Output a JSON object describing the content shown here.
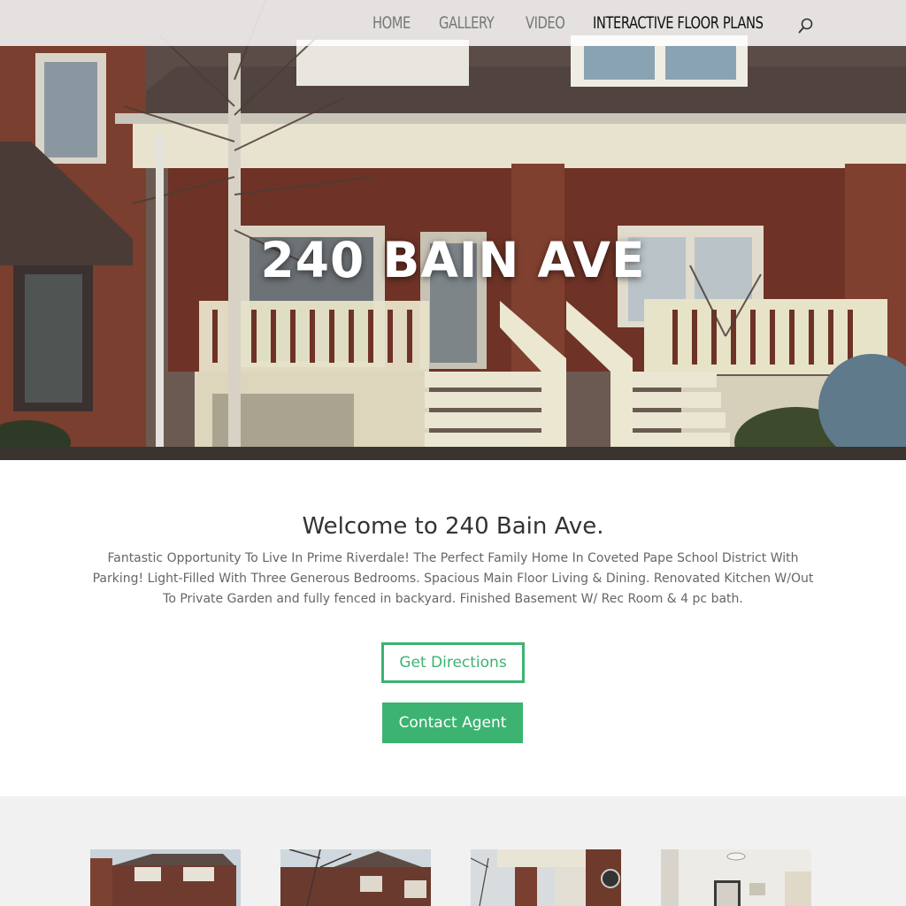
{
  "nav": {
    "items": [
      {
        "label": "HOME",
        "active": false
      },
      {
        "label": "GALLERY",
        "active": false
      },
      {
        "label": "VIDEO",
        "active": false
      },
      {
        "label": "INTERACTIVE FLOOR PLANS",
        "active": true
      }
    ],
    "search_icon": "search-icon"
  },
  "hero": {
    "title": "240 BAIN AVE"
  },
  "welcome": {
    "heading": "Welcome to 240 Bain Ave.",
    "description": "Fantastic Opportunity To Live In Prime Riverdale! The Perfect Family Home In Coveted Pape School District With Parking! Light-Filled With Three Generous Bedrooms. Spacious Main Floor Living & Dining. Renovated Kitchen W/Out To Private Garden and fully fenced in backyard. Finished Basement W/ Rec Room & 4 pc bath.",
    "directions_label": "Get Directions",
    "contact_label": "Contact Agent"
  },
  "colors": {
    "accent": "#3cb371",
    "strip_bg": "#f1f1f1"
  }
}
